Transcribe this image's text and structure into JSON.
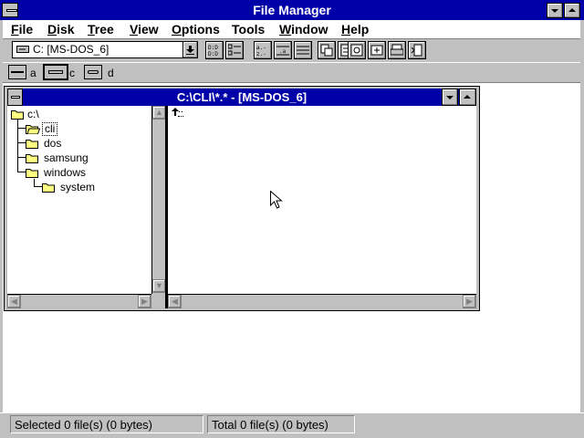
{
  "app": {
    "title": "File Manager"
  },
  "menu": [
    {
      "label_ul": "F",
      "label_rest": "ile"
    },
    {
      "label_ul": "D",
      "label_rest": "isk"
    },
    {
      "label_ul": "T",
      "label_rest": "ree"
    },
    {
      "label_ul": "V",
      "label_rest": "iew"
    },
    {
      "label_ul": "O",
      "label_rest": "ptions"
    },
    {
      "label_ul": "",
      "label_rest": "Tools"
    },
    {
      "label_ul": "W",
      "label_rest": "indow"
    },
    {
      "label_ul": "H",
      "label_rest": "elp"
    }
  ],
  "toolbar": {
    "drive_value": "C: [MS-DOS_6]"
  },
  "drives": [
    {
      "letter": "a"
    },
    {
      "letter": "c"
    },
    {
      "letter": "d"
    }
  ],
  "child": {
    "title": "C:\\CLI\\*.* - [MS-DOS_6]"
  },
  "tree": [
    {
      "label": "c:\\"
    },
    {
      "label": "cli"
    },
    {
      "label": "dos"
    },
    {
      "label": "samsung"
    },
    {
      "label": "windows"
    },
    {
      "label": "system"
    }
  ],
  "files": [
    {
      "label": ".."
    }
  ],
  "status": {
    "selected": "Selected 0 file(s) (0 bytes)",
    "total": "Total 0 file(s) (0 bytes)"
  }
}
